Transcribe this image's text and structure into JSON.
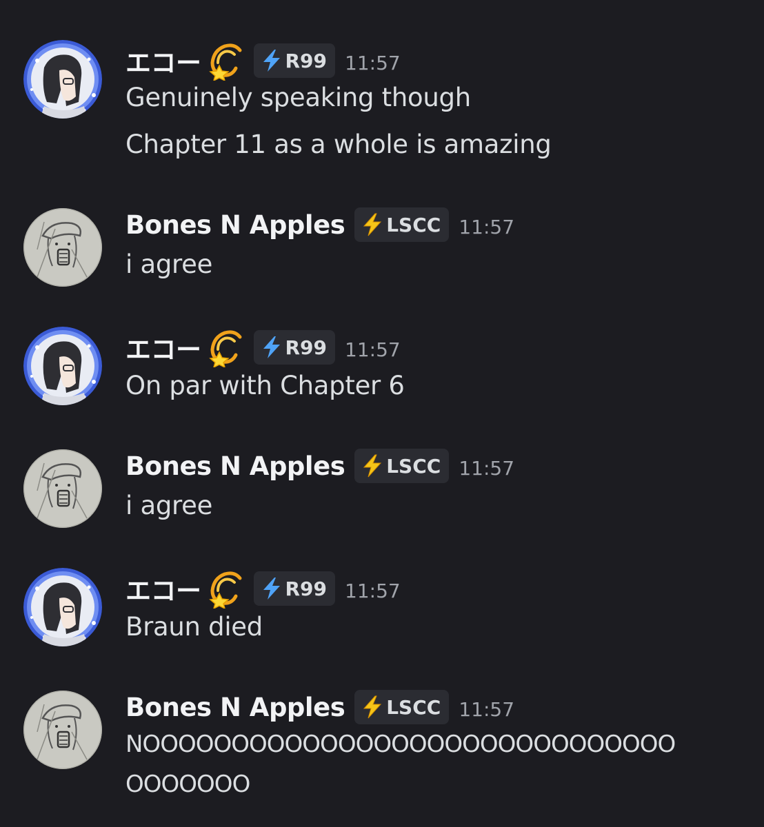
{
  "users": {
    "echo": {
      "name": "エコー",
      "name_emoji": "dizzy-star",
      "tag": "R99",
      "tag_icon": "lightning-bolt-blue",
      "tag_color": "#4fa3f7"
    },
    "bones": {
      "name": "Bones N Apples",
      "tag": "LSCC",
      "tag_icon": "lightning-bolt-yellow",
      "tag_color": "#f5c518"
    }
  },
  "messages": [
    {
      "author": "エコー",
      "tag": "R99",
      "time": "11:57",
      "lines": [
        "Genuinely speaking though",
        "Chapter 11 as a whole is amazing"
      ]
    },
    {
      "author": "Bones N Apples",
      "tag": "LSCC",
      "time": "11:57",
      "lines": [
        "i agree"
      ]
    },
    {
      "author": "エコー",
      "tag": "R99",
      "time": "11:57",
      "lines": [
        "On par with Chapter 6"
      ]
    },
    {
      "author": "Bones N Apples",
      "tag": "LSCC",
      "time": "11:57",
      "lines": [
        "i agree"
      ]
    },
    {
      "author": "エコー",
      "tag": "R99",
      "time": "11:57",
      "lines": [
        "Braun died"
      ]
    },
    {
      "author": "Bones N Apples",
      "tag": "LSCC",
      "time": "11:57",
      "lines": [
        "NOOOOOOOOOOOOOOOOOOOOOOOOOOOOOO",
        "OOOOOOO"
      ]
    }
  ],
  "colors": {
    "background": "#1c1c21",
    "tag_background": "#2b2c32",
    "author": "#f2f3f5",
    "message_text": "#dbdee1",
    "timestamp": "#a1a4ab"
  }
}
